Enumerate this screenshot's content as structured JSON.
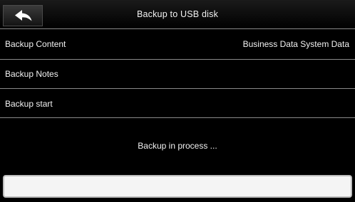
{
  "header": {
    "title": "Backup to USB disk",
    "back_icon": "back-arrow-icon"
  },
  "rows": [
    {
      "label": "Backup Content",
      "value": "Business Data System Data"
    },
    {
      "label": "Backup Notes"
    },
    {
      "label": "Backup start"
    }
  ],
  "status": {
    "text": "Backup in process ..."
  },
  "progress": {
    "fraction": 0
  },
  "colors": {
    "background": "#000000",
    "text": "#f2f2f2",
    "divider": "#8a8a8a",
    "progress_track": "#f4f4f4"
  }
}
